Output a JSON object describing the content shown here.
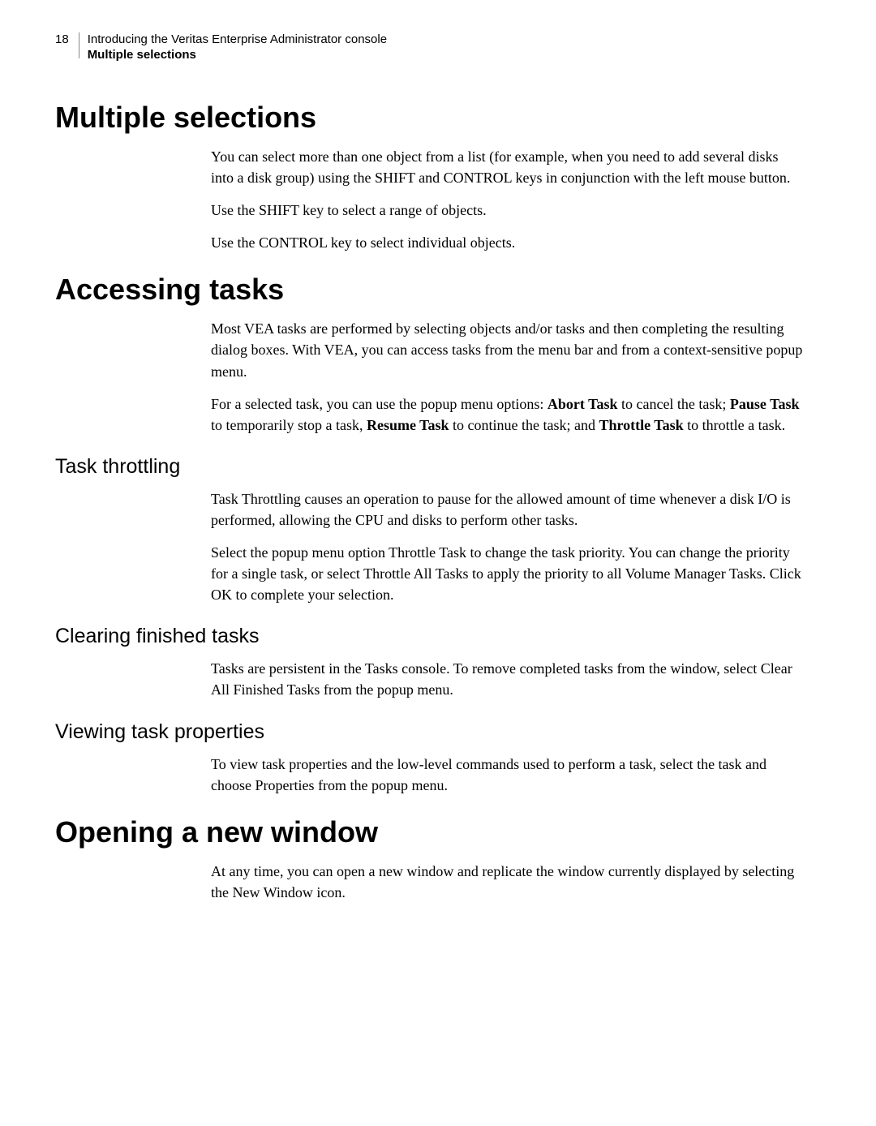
{
  "header": {
    "page_number": "18",
    "line1": "Introducing the Veritas Enterprise Administrator console",
    "line2": "Multiple selections"
  },
  "sections": {
    "multiple_selections": {
      "title": "Multiple selections",
      "p1": "You can select more than one object from a list (for example, when you need to add several disks into a disk group) using the SHIFT and CONTROL keys in conjunction with the left mouse button.",
      "p2": "Use the SHIFT key to select a range of objects.",
      "p3": "Use the CONTROL key to select individual objects."
    },
    "accessing_tasks": {
      "title": "Accessing tasks",
      "p1": "Most VEA tasks are performed by selecting objects and/or tasks and then completing the resulting dialog boxes. With VEA, you can access tasks from the menu bar and from a context-sensitive popup menu.",
      "p2_prefix": "For a selected task, you can use the popup menu options: ",
      "p2_b1": "Abort Task",
      "p2_t1": " to cancel the task; ",
      "p2_b2": "Pause Task",
      "p2_t2": " to temporarily stop a task, ",
      "p2_b3": "Resume Task",
      "p2_t3": " to continue the task; and ",
      "p2_b4": "Throttle Task",
      "p2_t4": " to throttle a task."
    },
    "task_throttling": {
      "title": "Task throttling",
      "p1": "Task Throttling causes an operation to pause for the allowed amount of time whenever a disk I/O is performed, allowing the CPU and disks to perform other tasks.",
      "p2": "Select the popup menu option Throttle Task to change the task priority. You can change the priority for a single task, or select Throttle All Tasks to apply the priority to all Volume Manager Tasks. Click OK to complete your selection."
    },
    "clearing_finished_tasks": {
      "title": "Clearing finished tasks",
      "p1": "Tasks are persistent in the Tasks console. To remove completed tasks from the window, select Clear All Finished Tasks from the popup menu."
    },
    "viewing_task_properties": {
      "title": "Viewing task properties",
      "p1": "To view task properties and the low-level commands used to perform a task, select the task and choose Properties from the popup menu."
    },
    "opening_new_window": {
      "title": "Opening a new window",
      "p1": "At any time, you can open a new window and replicate the window currently displayed by selecting the New Window icon."
    }
  }
}
